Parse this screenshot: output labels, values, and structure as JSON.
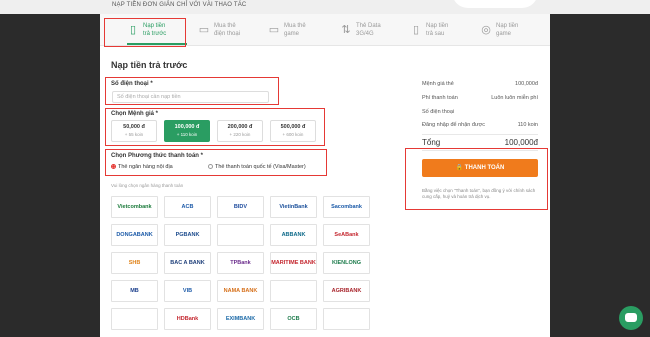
{
  "header": {
    "tagline": "NẠP TIỀN ĐƠN GIẢN CHỈ VỚI VÀI THAO TÁC"
  },
  "tabs": [
    {
      "label": "Nạp tiền\ntrả trước",
      "icon": "phone-icon",
      "active": true
    },
    {
      "label": "Mua thẻ\nđiện thoại",
      "icon": "card-icon",
      "active": false
    },
    {
      "label": "Mua thẻ\ngame",
      "icon": "card-icon",
      "active": false
    },
    {
      "label": "Thẻ Data\n3G/4G",
      "icon": "data-icon",
      "active": false
    },
    {
      "label": "Nạp tiền\ntrả sau",
      "icon": "phone-icon",
      "active": false
    },
    {
      "label": "Nạp tiền\ngame",
      "icon": "gamepad-icon",
      "active": false
    }
  ],
  "form": {
    "title": "Nạp tiền trả trước",
    "phone_label": "Số điện thoại *",
    "phone_placeholder": "Số điện thoại cần nạp tiền",
    "denom_label": "Chọn Mệnh giá *",
    "denoms": [
      {
        "value": "50,000 đ",
        "sub": "+ 55 koin",
        "selected": false
      },
      {
        "value": "100,000 đ",
        "sub": "+ 110 koin",
        "selected": true
      },
      {
        "value": "200,000 đ",
        "sub": "+ 220 koin",
        "selected": false
      },
      {
        "value": "500,000 đ",
        "sub": "+ 600 koin",
        "selected": false
      }
    ],
    "payment_label": "Chọn Phương thức thanh toán *",
    "payment_options": [
      {
        "label": "Thẻ ngân hàng nội địa",
        "selected": true
      },
      {
        "label": "Thẻ thanh toán quốc tế (Visa/Master)",
        "selected": false
      }
    ],
    "bank_hint": "Vui lòng chọn ngân hàng thanh toán"
  },
  "banks": [
    {
      "name": "Vietcombank",
      "color": "#1a7a3a"
    },
    {
      "name": "ACB",
      "color": "#1d5aa8"
    },
    {
      "name": "BIDV",
      "color": "#1c4a9c"
    },
    {
      "name": "VietinBank",
      "color": "#1a4f9a"
    },
    {
      "name": "Sacombank",
      "color": "#1b5aa8"
    },
    {
      "name": "DONGABANK",
      "color": "#1b5aa8"
    },
    {
      "name": "PGBANK",
      "color": "#1b4a8c"
    },
    {
      "name": "",
      "color": "#1a6aa8"
    },
    {
      "name": "ABBANK",
      "color": "#0e6a8a"
    },
    {
      "name": "SeABank",
      "color": "#c4262e"
    },
    {
      "name": "SHB",
      "color": "#e0831a"
    },
    {
      "name": "BAC A BANK",
      "color": "#1e3f7a"
    },
    {
      "name": "TPBank",
      "color": "#6b2c8c"
    },
    {
      "name": "MARITIME BANK",
      "color": "#c4262e"
    },
    {
      "name": "KIENLONG",
      "color": "#1b7a4a"
    },
    {
      "name": "MB",
      "color": "#1b3f8c"
    },
    {
      "name": "VIB",
      "color": "#1c5aa8"
    },
    {
      "name": "NAMA BANK",
      "color": "#d6701a"
    },
    {
      "name": "",
      "color": "#c4262e"
    },
    {
      "name": "AGRIBANK",
      "color": "#a8252c"
    },
    {
      "name": "",
      "color": "#c4262e"
    },
    {
      "name": "HDBank",
      "color": "#c4262e"
    },
    {
      "name": "EXIMBANK",
      "color": "#1c6aa8"
    },
    {
      "name": "OCB",
      "color": "#1b7a4a"
    },
    {
      "name": "",
      "color": "#c4262e"
    }
  ],
  "summary": {
    "rows": [
      {
        "key": "Mệnh giá thẻ",
        "value": "100,000đ"
      },
      {
        "key": "Phí thanh toán",
        "value": "Luôn luôn miễn phí"
      },
      {
        "key": "Số điện thoại",
        "value": ""
      },
      {
        "key": "Đăng nhập để nhận được",
        "value": "110 koin"
      }
    ],
    "total_label": "Tổng",
    "total_value": "100,000đ",
    "pay_button": "THANH TOÁN",
    "note": "Bằng việc chọn \"Thanh toán\", bạn đồng ý với chính sách cung cấp, huỷ và hoàn trả dịch vụ."
  },
  "colors": {
    "accent": "#2a9d62",
    "highlight": "#e53935",
    "pay": "#f07b1c"
  }
}
